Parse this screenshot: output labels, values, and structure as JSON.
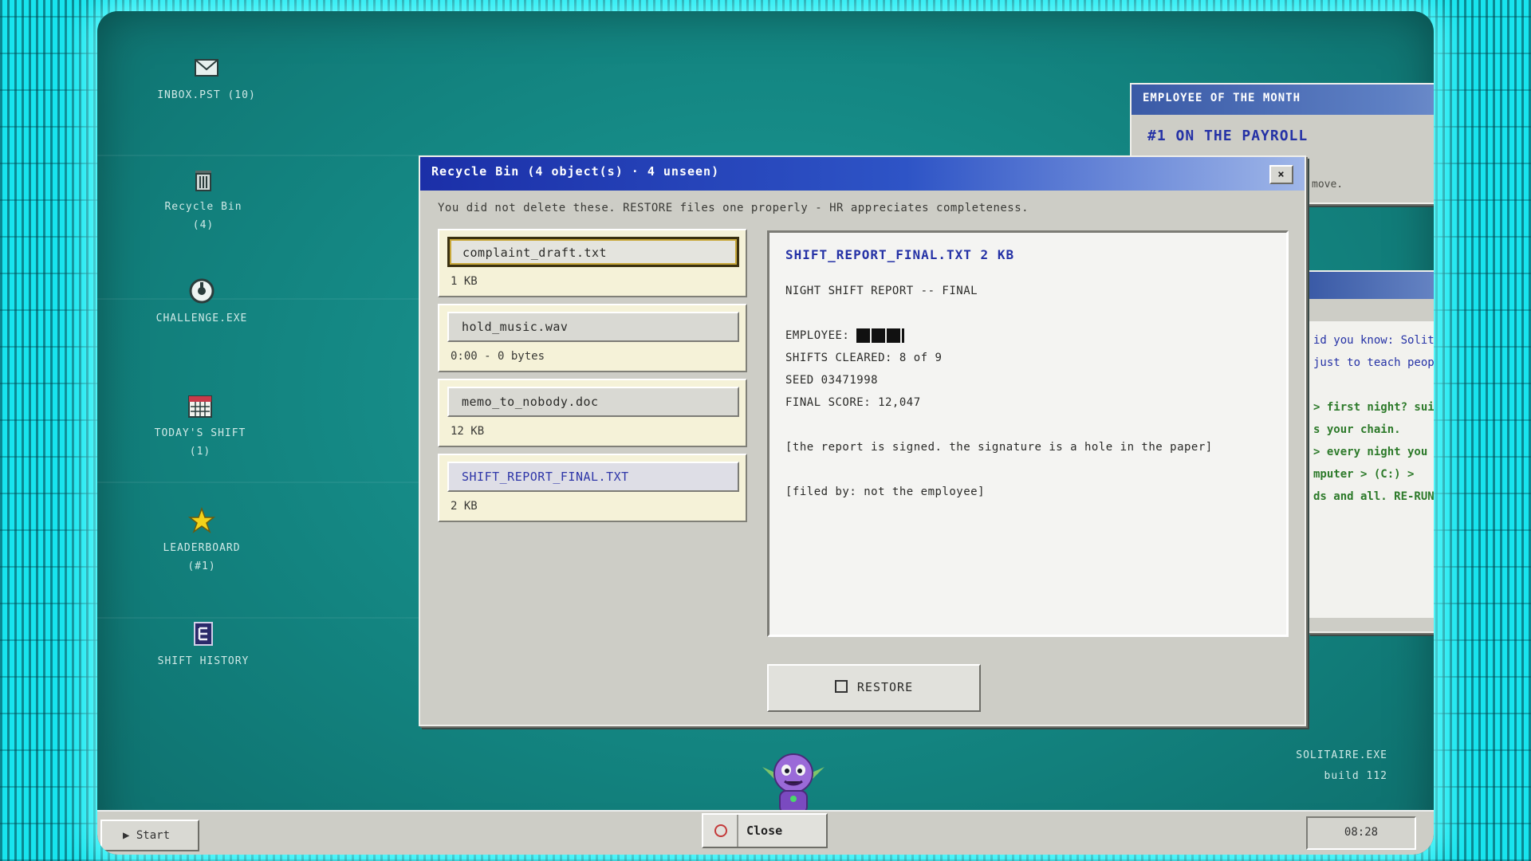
{
  "desktop": {
    "icons": [
      {
        "label": "INBOX.PST (10)",
        "sub": "",
        "icon": "envelope-icon"
      },
      {
        "label": "Recycle Bin",
        "sub": "(4)",
        "icon": "trash-icon"
      },
      {
        "label": "CHALLENGE.EXE",
        "sub": "",
        "icon": "challenge-icon"
      },
      {
        "label": "TODAY'S SHIFT",
        "sub": "(1)",
        "icon": "calendar-icon"
      },
      {
        "label": "LEADERBOARD",
        "sub": "(#1)",
        "icon": "star-icon"
      },
      {
        "label": "SHIFT HISTORY",
        "sub": "",
        "icon": "document-icon"
      }
    ],
    "build_title": "SOLITAIRE.EXE",
    "build_number": "build 112"
  },
  "recycle_bin": {
    "title": "Recycle Bin (4 object(s) · 4 unseen)",
    "close": "×",
    "message": "You did not delete these. RESTORE files one properly - HR appreciates completeness.",
    "files": [
      {
        "name": "complaint_draft.txt",
        "size": "1 KB"
      },
      {
        "name": "hold_music.wav",
        "size": "0:00 - 0 bytes"
      },
      {
        "name": "memo_to_nobody.doc",
        "size": "12 KB"
      },
      {
        "name": "SHIFT_REPORT_FINAL.TXT",
        "size": "2 KB"
      }
    ],
    "preview": {
      "header": "SHIFT_REPORT_FINAL.TXT  2 KB",
      "line1": "NIGHT SHIFT REPORT -- FINAL",
      "employee_label": "EMPLOYEE:",
      "shifts": "SHIFTS CLEARED: 8 of 9",
      "seed": "SEED 03471998",
      "score": "FINAL SCORE: 12,047",
      "signed": "[the report is signed. the signature is a hole in the paper]",
      "filed": "[filed by: not the employee]"
    },
    "restore_label": "RESTORE"
  },
  "eom_window": {
    "title": "EMPLOYEE OF THE MONTH",
    "headline": "#1 ON THE PAYROLL",
    "small": "move."
  },
  "tip_window": {
    "close": "×",
    "lines": [
      "id you know: Solitaire",
      "just to teach people how to",
      "",
      "> first night? suit slots",
      "s your chain.",
      "> every night you ever",
      "mputer > (C:) >",
      "ds and all. RE-RUN"
    ]
  },
  "taskbar": {
    "start": "Start",
    "close_label": "Close",
    "clock": "08:28"
  },
  "colors": {
    "title_blue": "#1b2fa8",
    "accent_cyan": "#18e4ee",
    "tip_green": "#2d7a2a"
  }
}
